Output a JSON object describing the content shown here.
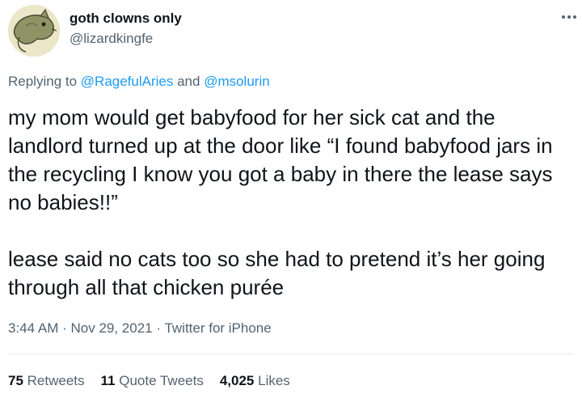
{
  "author": {
    "display_name": "goth clowns only",
    "handle": "@lizardkingfe",
    "avatar_icon": "possum-drawing-avatar"
  },
  "more_icon": "more-options-icon",
  "reply": {
    "prefix": "Replying to ",
    "mention_1": "@RagefulAries",
    "separator": " and ",
    "mention_2": "@msolurin"
  },
  "tweet": {
    "paragraph_1": "my mom would get babyfood for her sick cat and the landlord turned up at the door like “I found babyfood jars in the recycling I know you got a baby in there the lease says no babies!!”",
    "paragraph_2": "lease said no cats too so she had to pretend it’s her going through all that chicken purée"
  },
  "meta": {
    "time": "3:44 AM",
    "dot": " · ",
    "date": "Nov 29, 2021",
    "source": "Twitter for iPhone"
  },
  "stats": {
    "retweets_count": "75",
    "retweets_label": "Retweets",
    "quotes_count": "11",
    "quotes_label": "Quote Tweets",
    "likes_count": "4,025",
    "likes_label": "Likes"
  },
  "colors": {
    "link_blue": "#1d9bf0",
    "secondary_text": "#536471",
    "primary_text": "#0f1419"
  }
}
